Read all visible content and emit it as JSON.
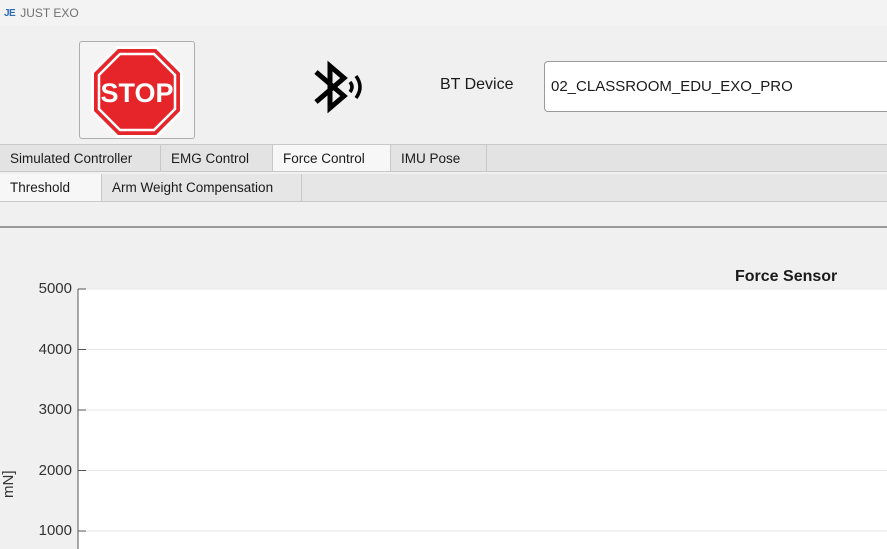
{
  "app": {
    "icon_text": "JE",
    "title": "JUST EXO"
  },
  "toolbar": {
    "stop_label": "STOP",
    "bt_label": "BT Device",
    "bt_device_value": "02_CLASSROOM_EDU_EXO_PRO"
  },
  "tabs": [
    {
      "label": "Simulated Controller",
      "active": false
    },
    {
      "label": "EMG Control",
      "active": false
    },
    {
      "label": "Force Control",
      "active": true
    },
    {
      "label": "IMU Pose",
      "active": false
    }
  ],
  "subtabs": [
    {
      "label": "Threshold",
      "active": true
    },
    {
      "label": "Arm Weight Compensation",
      "active": false
    }
  ],
  "colors": {
    "stop_red": "#e5252a",
    "tab_active": "#f7f7f7"
  },
  "chart_data": {
    "type": "line",
    "title": "Force Sensor",
    "ylabel": "mN]",
    "yticks": [
      5000,
      4000,
      3000,
      2000,
      1000
    ],
    "ylim": [
      1000,
      5000
    ],
    "grid": true,
    "series": []
  }
}
